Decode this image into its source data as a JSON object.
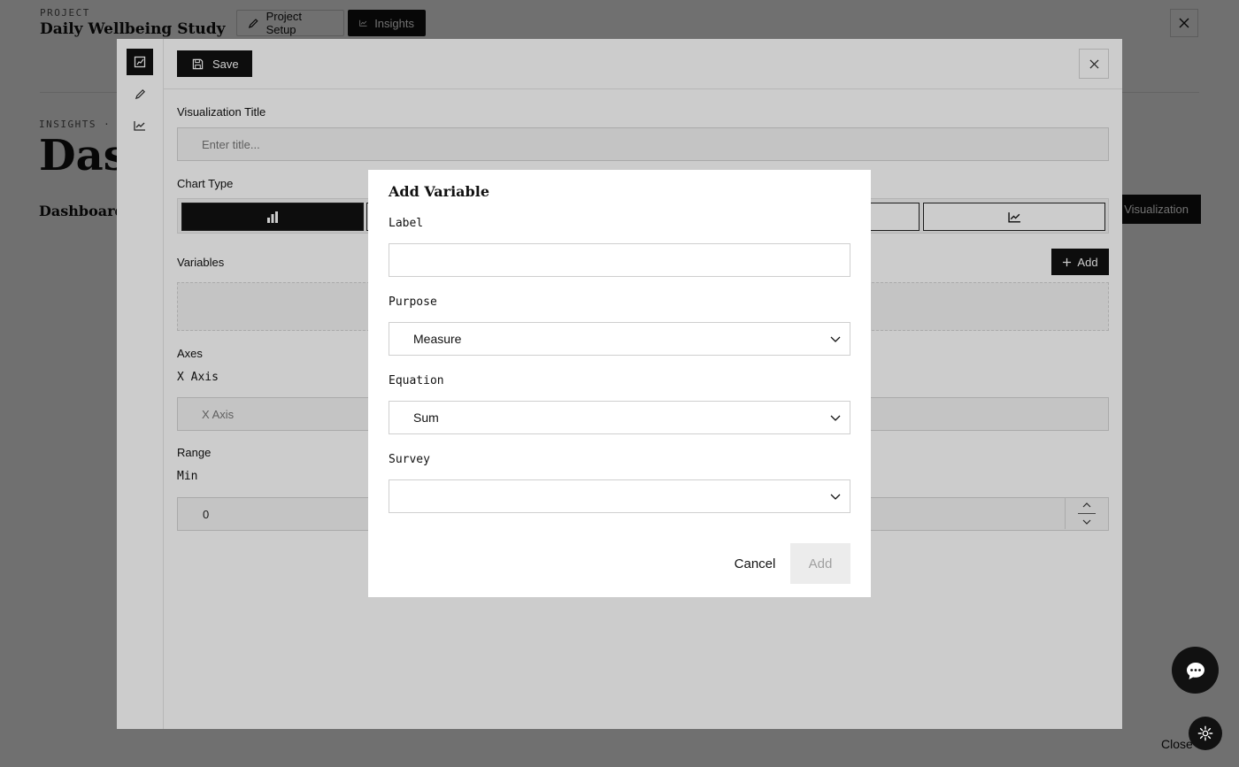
{
  "project": {
    "label": "PROJECT",
    "name": "Daily Wellbeing Study",
    "tabs": [
      {
        "label": "Project Setup",
        "icon": "pencil-icon"
      },
      {
        "label": "Insights",
        "icon": "line-chart-icon",
        "active": true
      }
    ]
  },
  "page": {
    "breadcrumb": "INSIGHTS · DA",
    "title": "Dash",
    "subtitle": "Dashboards",
    "new_viz_label": "Visualization",
    "close_label": "Close"
  },
  "editor": {
    "save_label": "Save",
    "title_label": "Visualization Title",
    "title_placeholder": "Enter title...",
    "chart_type_label": "Chart Type",
    "chart_types": [
      {
        "icon": "bar-chart-icon",
        "selected": true
      },
      {
        "icon": "line-chart-icon",
        "selected": false
      }
    ],
    "variables_label": "Variables",
    "add_label": "Add",
    "axes_label": "Axes",
    "x_axis_label": "X Axis",
    "x_axis_placeholder": "X Axis",
    "range_label": "Range",
    "min_label": "Min",
    "min_value": "0"
  },
  "dialog": {
    "title": "Add Variable",
    "label_field": {
      "label": "Label",
      "value": ""
    },
    "purpose": {
      "label": "Purpose",
      "value": "Measure"
    },
    "equation": {
      "label": "Equation",
      "value": "Sum"
    },
    "survey": {
      "label": "Survey",
      "value": ""
    },
    "cancel_label": "Cancel",
    "add_label": "Add"
  },
  "colors": {
    "primary": "#111111",
    "overlay": "rgba(0,0,0,0.45)",
    "disabled_bg": "#ececec",
    "disabled_text": "#a0a0a0"
  }
}
